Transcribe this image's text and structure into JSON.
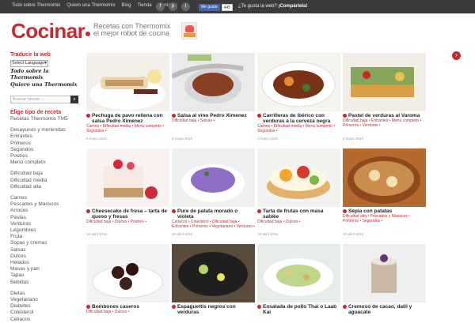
{
  "topnav": [
    "Todo sobre Thermomix",
    "Quiero una Thermomix",
    "Blog",
    "Tienda",
    "Contacto"
  ],
  "social": [
    {
      "icon": "facebook-icon",
      "glyph": "f"
    },
    {
      "icon": "pinterest-icon",
      "glyph": "p"
    },
    {
      "icon": "twitter-icon",
      "glyph": "t"
    }
  ],
  "like": {
    "label": "Me gusta",
    "count": "445"
  },
  "share": {
    "text": "¿Te gusta la web?",
    "cta": "¡Compártela!"
  },
  "header": {
    "logo": "Cocinar",
    "tagline1": "Recetas con Thermomix",
    "tagline2": "el mejor robot de cocina"
  },
  "sidebar": {
    "translate_title": "Traducir la web",
    "language_select": "Select Language",
    "script_links": [
      "Todo sobre la Thermomix",
      "Quiero una Thermomix"
    ],
    "search_placeholder": "Buscar receta ...",
    "recipe_type_title": "Elige tipo de receta",
    "groups": [
      [
        "Recetas Thermomix TM5"
      ],
      [
        "Desayunos y meriendas",
        "Entrantes",
        "Primeros",
        "Segundos",
        "Postres",
        "Menú completo"
      ],
      [
        "Dificultad baja",
        "Dificultad media",
        "Dificultad alta"
      ],
      [
        "Carnes",
        "Pescados y Mariscos",
        "Arroces",
        "Pastas",
        "Verduras",
        "Legumbres",
        "Fruta",
        "Sopas y cremas",
        "Salsas",
        "Dulces",
        "Helados",
        "Masas y pan",
        "Tapas",
        "Bebidas"
      ],
      [
        "Dietas",
        "Vegetariano",
        "Diabetes",
        "Colesterol",
        "Celíacos"
      ]
    ]
  },
  "cards": [
    {
      "title": "Pechuga de pavo rellena con salsa Pedro Ximenez",
      "cats": "Carnes • Dificultad media • Menú completo • Segundos •",
      "date": "6 mayo 2016"
    },
    {
      "title": "Salsa al vino Pedro Ximenez",
      "cats": "Dificultad baja • Salsas •",
      "date": "5 mayo 2016"
    },
    {
      "title": "Carrilleras de ibérico con verduras a la cerveza negra",
      "cats": "Carnes • Dificultad media • Menú completo • Segundos •",
      "date": "3 mayo 2016"
    },
    {
      "title": "Pastel de verduras al Varoma",
      "cats": "Dificultad baja • Entrantes • Menú completo • Primeros • Verduras •",
      "date": "2 mayo 2016"
    },
    {
      "title": "Cheesecake de fresa – tarta de queso y fresas",
      "cats": "Dificultad baja • Dulces • Postres •",
      "date": "28 abril 2016"
    },
    {
      "title": "Pure de patata morado o violeta",
      "cats": "Celíacos • Colesterol • Dificultad baja • Entrantes • Primeros • Vegetariano • Verduras •",
      "date": "20 abril 2016"
    },
    {
      "title": "Tarta de frutas con masa sablée",
      "cats": "Dificultad baja • Dulces •",
      "date": "15 abril 2016"
    },
    {
      "title": "Sepia con patatas",
      "cats": "Dificultad alta • Pescados y Mariscos • Primeros • Segundos •",
      "date": "13 abril 2016"
    },
    {
      "title": "Bombones caseros",
      "cats": "Dificultad baja • Dulces •",
      "date": ""
    },
    {
      "title": "Espaguettis negros con verduras",
      "cats": "",
      "date": ""
    },
    {
      "title": "Ensalada de pollo Thai o Laab Kai",
      "cats": "",
      "date": ""
    },
    {
      "title": "Cremoso de cacao, datil y aguacate",
      "cats": "",
      "date": ""
    }
  ]
}
